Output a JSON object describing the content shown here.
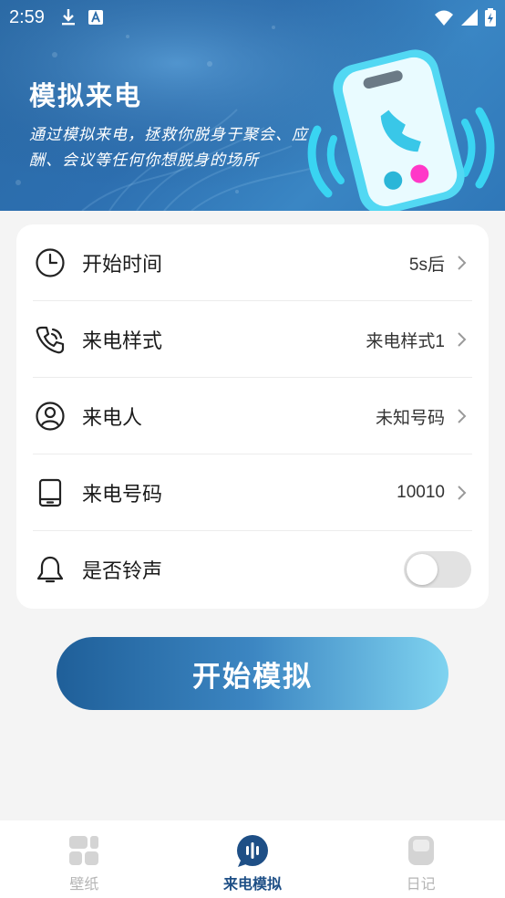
{
  "status_bar": {
    "time": "2:59"
  },
  "banner": {
    "title": "模拟来电",
    "description": "通过模拟来电，拯救你脱身于聚会、应酬、会议等任何你想脱身的场所"
  },
  "settings": {
    "start_time": {
      "label": "开始时间",
      "value": "5s后"
    },
    "call_style": {
      "label": "来电样式",
      "value": "来电样式1"
    },
    "caller": {
      "label": "来电人",
      "value": "未知号码"
    },
    "number": {
      "label": "来电号码",
      "value": "10010"
    },
    "ringtone": {
      "label": "是否铃声",
      "enabled": false
    }
  },
  "start_button": "开始模拟",
  "bottom_nav": {
    "items": [
      {
        "label": "壁纸",
        "icon": "wallpaper-icon",
        "active": false
      },
      {
        "label": "来电模拟",
        "icon": "call-simulation-icon",
        "active": true
      },
      {
        "label": "日记",
        "icon": "diary-icon",
        "active": false
      }
    ]
  },
  "colors": {
    "accent": "#1e4f86",
    "button_gradient_start": "#1f5f99",
    "button_gradient_end": "#7fd3f0",
    "toggle_off": "#e2e2e2"
  }
}
